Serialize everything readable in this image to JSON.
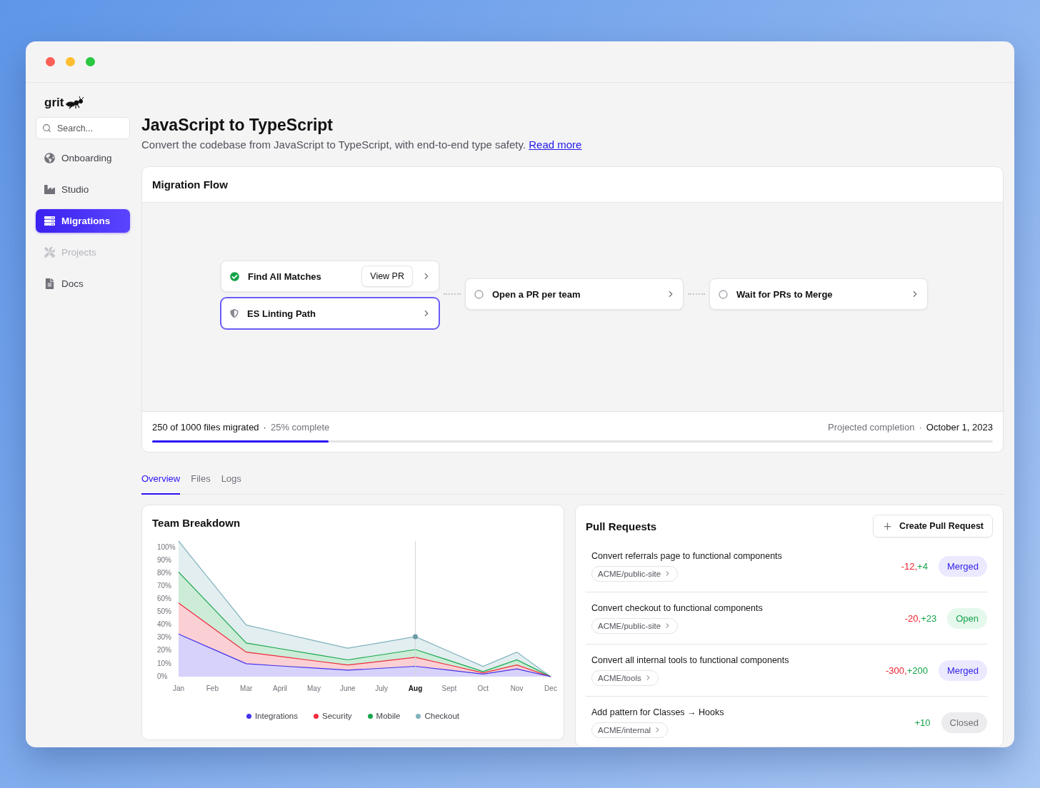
{
  "sidebar": {
    "logo": "grit",
    "search": {
      "placeholder": "Search..."
    },
    "items": [
      {
        "label": "Onboarding",
        "selected": false,
        "disabled": false
      },
      {
        "label": "Studio",
        "selected": false,
        "disabled": false
      },
      {
        "label": "Migrations",
        "selected": true,
        "disabled": false
      },
      {
        "label": "Projects",
        "selected": false,
        "disabled": true
      },
      {
        "label": "Docs",
        "selected": false,
        "disabled": false
      }
    ]
  },
  "header": {
    "title": "JavaScript to TypeScript",
    "description": "Convert the codebase from JavaScript to TypeScript, with end-to-end type safety.",
    "link": "Read more"
  },
  "migration_flow": {
    "title": "Migration Flow",
    "columns": [
      {
        "nodes": [
          {
            "label": "Find All Matches",
            "kind": "done",
            "selected": false,
            "action": "View PR"
          },
          {
            "label": "ES Linting Path",
            "kind": "blocked",
            "selected": true
          }
        ]
      },
      {
        "nodes": [
          {
            "label": "Open a PR per team",
            "kind": "pending",
            "selected": false
          }
        ]
      },
      {
        "nodes": [
          {
            "label": "Wait for PRs to Merge",
            "kind": "pending",
            "selected": false
          }
        ]
      }
    ],
    "progress": {
      "migrated": "250 of 1000 files migrated",
      "separator": "·",
      "percent": "25% complete",
      "projected_label": "Projected completion",
      "projected_separator": "·",
      "projected_date": "October 1, 2023",
      "level": 0.21
    }
  },
  "tabs": [
    {
      "label": "Overview",
      "selected": true
    },
    {
      "label": "Files",
      "selected": false
    },
    {
      "label": "Logs",
      "selected": false
    }
  ],
  "team_breakdown": {
    "title": "Team Breakdown",
    "chart_data": {
      "type": "area",
      "stacked": false,
      "categories": [
        "Jan",
        "Feb",
        "Mar",
        "April",
        "May",
        "June",
        "July",
        "Aug",
        "Sept",
        "Oct",
        "Nov",
        "Dec"
      ],
      "ylim": [
        0,
        105
      ],
      "yticks": [
        {
          "value": 0,
          "label": "0%"
        },
        {
          "value": 10,
          "label": "10%"
        },
        {
          "value": 20,
          "label": "20%"
        },
        {
          "value": 30,
          "label": "30%"
        },
        {
          "value": 40,
          "label": "40%"
        },
        {
          "value": 50,
          "label": "50%"
        },
        {
          "value": 60,
          "label": "60%"
        },
        {
          "value": 70,
          "label": "70%"
        },
        {
          "value": 80,
          "label": "80%"
        },
        {
          "value": 90,
          "label": "90%"
        },
        {
          "value": 100,
          "label": "100%"
        }
      ],
      "series": [
        {
          "name": "Integrations",
          "color": "#4433ee",
          "values": [
            33,
            21.5,
            10,
            8.3,
            6.7,
            5,
            6.5,
            8,
            5,
            2,
            6,
            0
          ]
        },
        {
          "name": "Security",
          "color": "#ef2a3a",
          "values": [
            57,
            38,
            19,
            15.7,
            12.3,
            9,
            12,
            15,
            9,
            3,
            9,
            0
          ]
        },
        {
          "name": "Mobile",
          "color": "#17a84c",
          "values": [
            81,
            53.5,
            26,
            21.7,
            17.3,
            13,
            17,
            21,
            12.5,
            4,
            13,
            0
          ]
        },
        {
          "name": "Checkout",
          "color": "#7fb2bd",
          "values": [
            105,
            72.5,
            40,
            34,
            28,
            22,
            26.5,
            31,
            19.5,
            8,
            19,
            0
          ]
        }
      ],
      "annotations": [
        {
          "x": "Aug"
        }
      ]
    }
  },
  "pull_requests": {
    "title": "Pull Requests",
    "create_button": "Create Pull Request",
    "items": [
      {
        "title": "Convert referrals page to functional components",
        "repo": "ACME/public-site",
        "changes": [
          {
            "text": "-12,",
            "kind": "removed"
          },
          {
            "text": "+4",
            "kind": "added"
          }
        ],
        "status": "Merged",
        "kind": "merged"
      },
      {
        "title": "Convert checkout to functional components",
        "repo": "ACME/public-site",
        "changes": [
          {
            "text": "-20,",
            "kind": "removed"
          },
          {
            "text": "+23",
            "kind": "added"
          }
        ],
        "status": "Open",
        "kind": "open"
      },
      {
        "title": "Convert all internal tools to functional components",
        "repo": "ACME/tools",
        "changes": [
          {
            "text": "-300,",
            "kind": "removed"
          },
          {
            "text": "+200",
            "kind": "added"
          }
        ],
        "status": "Merged",
        "kind": "merged"
      },
      {
        "title": "Add pattern for Classes → Hooks",
        "repo": "ACME/internal",
        "changes": [
          {
            "text": "+10",
            "kind": "added"
          }
        ],
        "status": "Closed",
        "kind": "closed"
      }
    ]
  }
}
